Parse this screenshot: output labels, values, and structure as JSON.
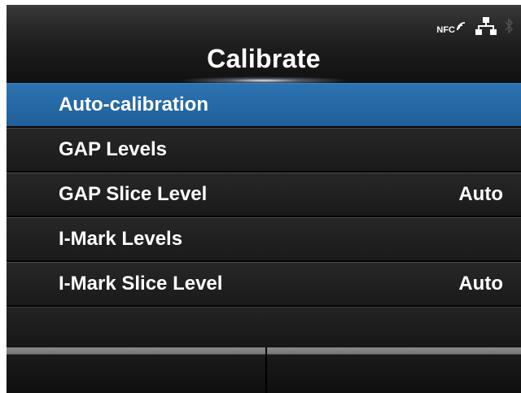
{
  "header": {
    "title": "Calibrate",
    "status": {
      "nfc_label": "NFC",
      "icons": [
        "nfc-icon",
        "network-icon",
        "bluetooth-icon"
      ]
    }
  },
  "menu": {
    "items": [
      {
        "label": "Auto-calibration",
        "value": "",
        "selected": true
      },
      {
        "label": "GAP Levels",
        "value": ""
      },
      {
        "label": "GAP Slice Level",
        "value": "Auto"
      },
      {
        "label": "I-Mark Levels",
        "value": ""
      },
      {
        "label": "I-Mark Slice Level",
        "value": "Auto"
      }
    ]
  },
  "colors": {
    "selected": "#2c73b1",
    "background": "#000000",
    "text": "#ffffff"
  }
}
